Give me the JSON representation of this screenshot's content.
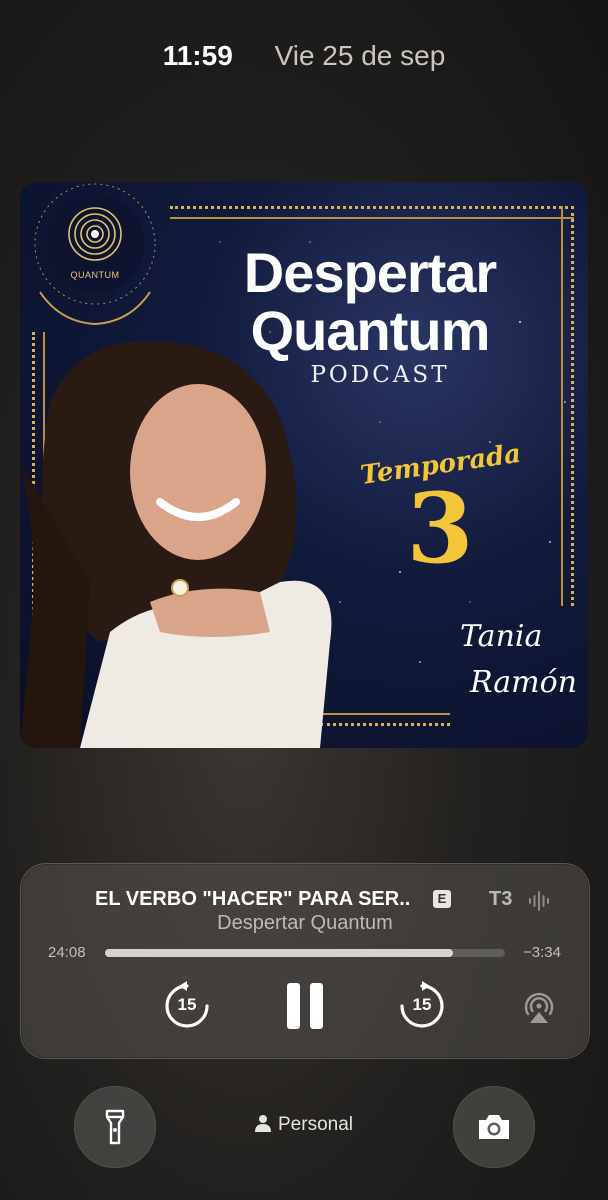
{
  "status": {
    "time": "11:59",
    "date": "Vie 25 de sep"
  },
  "artwork": {
    "title_line1": "Despertar",
    "title_line2": "Quantum",
    "subtitle": "PODCAST",
    "season_label": "Temporada",
    "season_number": "3",
    "signature_line1": "Tania",
    "signature_line2": "Ramón",
    "logo_text": "QUANTUM",
    "accent_color": "#f3c63a"
  },
  "player": {
    "track_title": "EL VERBO \"HACER\" PARA SER..",
    "explicit_badge": "E",
    "track_title_tail": "T3",
    "show_name": "Despertar Quantum",
    "elapsed": "24:08",
    "remaining": "−3:34",
    "progress": 0.87,
    "skip_back_seconds": "15",
    "skip_forward_seconds": "15",
    "icons": [
      "waveform-icon",
      "skip-back-15-icon",
      "pause-icon",
      "skip-forward-15-icon",
      "airplay-icon"
    ]
  },
  "bottom": {
    "focus_label": "Personal",
    "left_button_icon": "flashlight-icon",
    "right_button_icon": "camera-icon"
  }
}
